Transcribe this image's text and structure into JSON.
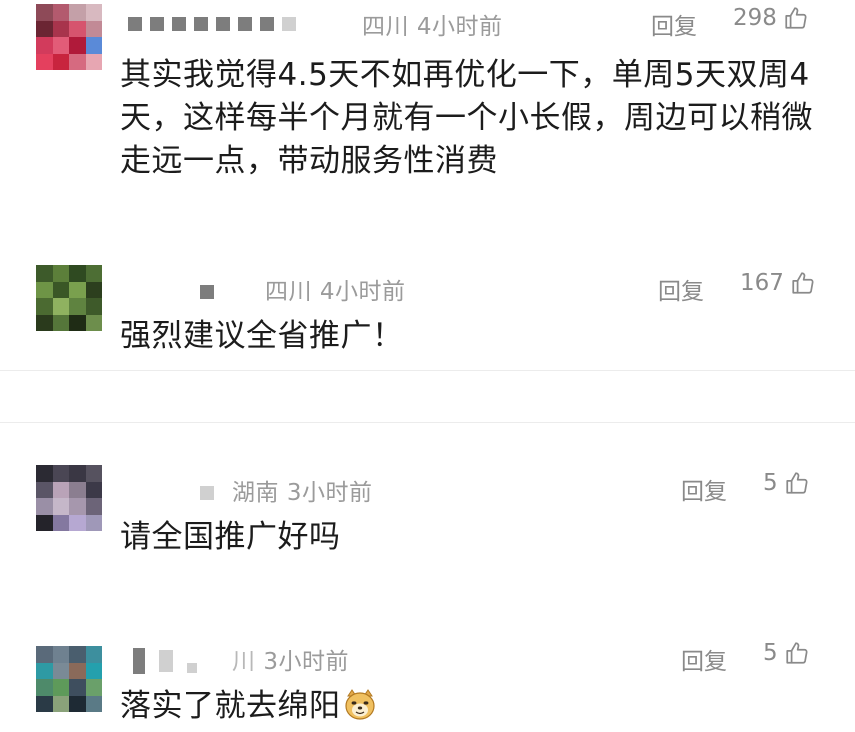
{
  "comments": [
    {
      "location": "四川",
      "time": "4小时前",
      "reply_label": "回复",
      "likes": "298",
      "text": "其实我觉得4.5天不如再优化一下，单周5天双周4天，这样每半个月就有一个小长假，周边可以稍微走远一点，带动服务性消费"
    },
    {
      "location": "四川",
      "time": "4小时前",
      "reply_label": "回复",
      "likes": "167",
      "text": "强烈建议全省推广！"
    },
    {
      "location": "湖南",
      "time": "3小时前",
      "reply_label": "回复",
      "likes": "5",
      "text": "请全国推广好吗"
    },
    {
      "location_fragment": "川",
      "time": "3小时前",
      "reply_label": "回复",
      "likes": "5",
      "text": "落实了就去绵阳",
      "emoji": "doge-emoji"
    }
  ],
  "icons": {
    "like": "thumbs-up-icon"
  },
  "colors": {
    "meta_text": "#9b9b9b",
    "body_text": "#1c1c1c",
    "divider": "#ececec"
  }
}
